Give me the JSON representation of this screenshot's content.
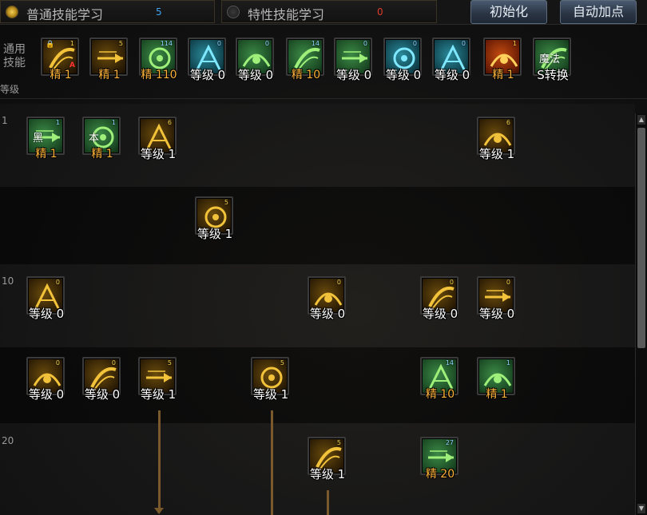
{
  "tabs": [
    {
      "label": "普通技能学习",
      "count": "5",
      "active": true
    },
    {
      "label": "特性技能学习",
      "count": "0",
      "active": false
    }
  ],
  "buttons": {
    "reset": "初始化",
    "auto": "自动加点"
  },
  "common": {
    "side_label_1": "通用",
    "side_label_2": "技能",
    "level_header": "等级",
    "skills": [
      {
        "icon": "buff-flex-icon",
        "color": "gold",
        "badge": "1",
        "caption": "精 1",
        "elite": true,
        "lock": true
      },
      {
        "icon": "lion-roar-icon",
        "color": "gold",
        "badge": "5",
        "caption": "精 1",
        "elite": true
      },
      {
        "icon": "dash-strike-icon",
        "color": "green",
        "badge": "114",
        "caption": "精 110",
        "elite": true
      },
      {
        "icon": "wings-icon",
        "color": "teal",
        "badge": "0",
        "caption": "等级 0",
        "elite": false
      },
      {
        "icon": "sit-rest-icon",
        "color": "green",
        "badge": "0",
        "caption": "等级 0",
        "elite": false
      },
      {
        "icon": "target-crosshair-icon",
        "color": "green",
        "badge": "14",
        "caption": "精 10",
        "elite": true
      },
      {
        "icon": "silhouette-icon",
        "color": "green",
        "badge": "0",
        "caption": "等级 0",
        "elite": false
      },
      {
        "icon": "eye-ring-icon",
        "color": "teal",
        "badge": "0",
        "caption": "等级 0",
        "elite": false
      },
      {
        "icon": "aura-man-icon",
        "color": "teal",
        "badge": "0",
        "caption": "等级 0",
        "elite": false
      },
      {
        "icon": "flame-burst-icon",
        "color": "fire",
        "badge": "1",
        "caption": "精 1",
        "elite": true
      },
      {
        "icon": "magic-swap-icon",
        "color": "green",
        "badge": "",
        "caption": "S转换",
        "elite": false,
        "text": "魔法"
      }
    ]
  },
  "rows": [
    {
      "level": "1",
      "skills": [
        {
          "icon": "tree-bark-icon",
          "color": "green",
          "badge": "1",
          "caption": "精 1",
          "elite": true,
          "text": "黑"
        },
        {
          "icon": "rune-frame-icon",
          "color": "green",
          "badge": "1",
          "caption": "精 1",
          "elite": true,
          "text": "本"
        },
        {
          "icon": "thrust-line-icon",
          "color": "gold",
          "badge": "6",
          "caption": "等级 1",
          "elite": false
        },
        {
          "icon": "scythe-slash-icon",
          "color": "gold",
          "badge": "6",
          "caption": "等级 1",
          "elite": false
        }
      ]
    },
    {
      "level": "",
      "skills": [
        {
          "icon": "arc-slash-icon",
          "color": "gold",
          "badge": "5",
          "caption": "等级 1",
          "elite": false
        }
      ]
    },
    {
      "level": "10",
      "skills": [
        {
          "icon": "crescent-icon",
          "color": "gold",
          "badge": "0",
          "caption": "等级 0",
          "elite": false
        },
        {
          "icon": "whirl-disc-icon",
          "color": "gold",
          "badge": "0",
          "caption": "等级 0",
          "elite": false
        },
        {
          "icon": "spear-burst-icon",
          "color": "gold",
          "badge": "0",
          "caption": "等级 0",
          "elite": false
        },
        {
          "icon": "leap-strike-icon",
          "color": "gold",
          "badge": "0",
          "caption": "等级 0",
          "elite": false
        }
      ]
    },
    {
      "level": "",
      "skills": [
        {
          "icon": "wave-slash-icon",
          "color": "gold",
          "badge": "0",
          "caption": "等级 0",
          "elite": false
        },
        {
          "icon": "double-slash-icon",
          "color": "gold",
          "badge": "0",
          "caption": "等级 0",
          "elite": false
        },
        {
          "icon": "shatter-icon",
          "color": "gold",
          "badge": "5",
          "caption": "等级 1",
          "elite": false
        },
        {
          "icon": "spark-rush-icon",
          "color": "gold",
          "badge": "5",
          "caption": "等级 1",
          "elite": false
        },
        {
          "icon": "green-fighter-icon",
          "color": "green",
          "badge": "14",
          "caption": "精 10",
          "elite": true
        },
        {
          "icon": "green-kick-icon",
          "color": "green",
          "badge": "1",
          "caption": "精 1",
          "elite": true
        }
      ]
    },
    {
      "level": "20",
      "skills": [
        {
          "icon": "block-stack-icon",
          "color": "gold",
          "badge": "5",
          "caption": "等级 1",
          "elite": false
        },
        {
          "icon": "green-blade-icon",
          "color": "green",
          "badge": "27",
          "caption": "精 20",
          "elite": true
        }
      ]
    }
  ]
}
